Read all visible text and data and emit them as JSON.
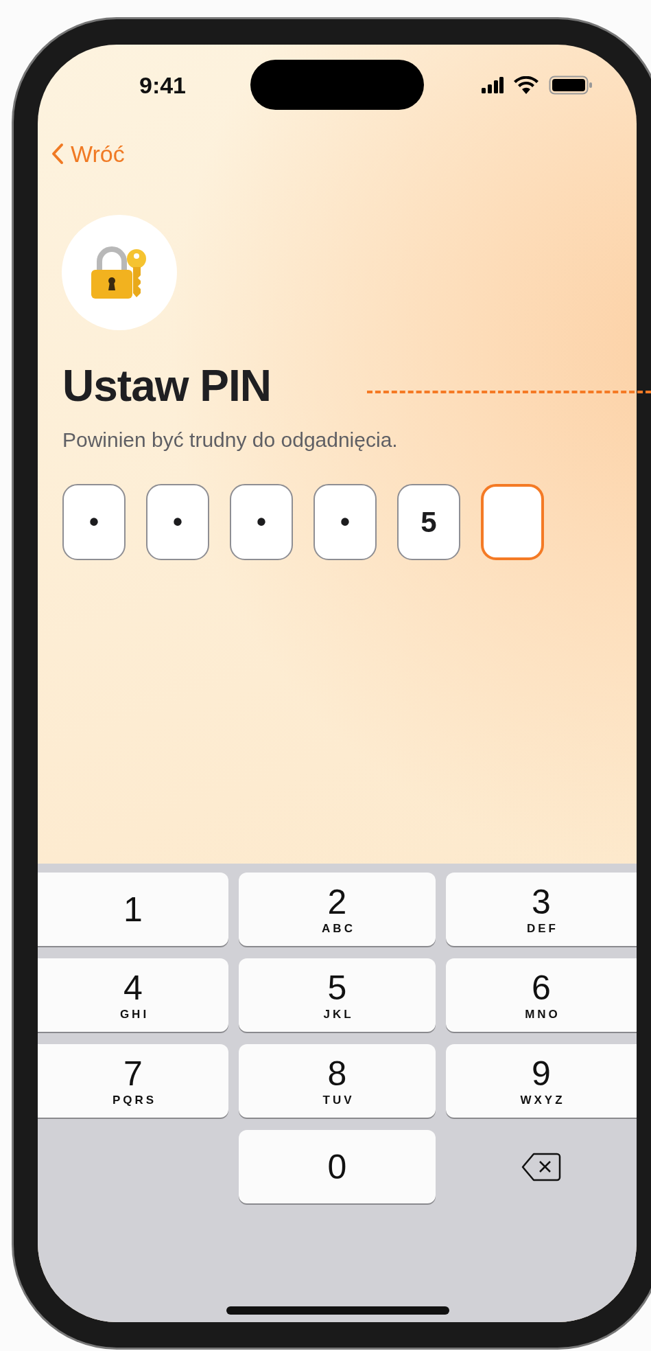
{
  "status_bar": {
    "time": "9:41"
  },
  "nav": {
    "back_label": "Wróć"
  },
  "title": "Ustaw PIN",
  "subtitle": "Powinien być trudny do odgadnięcia.",
  "pin_fields": [
    {
      "kind": "masked",
      "value": "•",
      "selected": false
    },
    {
      "kind": "masked",
      "value": "•",
      "selected": false
    },
    {
      "kind": "masked",
      "value": "•",
      "selected": false
    },
    {
      "kind": "masked",
      "value": "•",
      "selected": false
    },
    {
      "kind": "digit",
      "value": "5",
      "selected": false
    },
    {
      "kind": "empty",
      "selected": true
    }
  ],
  "keypad": {
    "keys": [
      {
        "kind": "digit",
        "digit": "1"
      },
      {
        "kind": "digit",
        "digit": "2",
        "letters": "ABC"
      },
      {
        "kind": "digit",
        "digit": "3",
        "letters": "DEF"
      },
      {
        "kind": "digit",
        "digit": "4",
        "letters": "GHI"
      },
      {
        "kind": "digit",
        "digit": "5",
        "letters": "JKL"
      },
      {
        "kind": "digit",
        "digit": "6",
        "letters": "MNO"
      },
      {
        "kind": "digit",
        "digit": "7",
        "letters": "PQRS"
      },
      {
        "kind": "digit",
        "digit": "8",
        "letters": "TUV"
      },
      {
        "kind": "digit",
        "digit": "9",
        "letters": "WXYZ"
      },
      {
        "kind": "blank"
      },
      {
        "kind": "digit",
        "digit": "0"
      },
      {
        "kind": "delete"
      }
    ]
  }
}
